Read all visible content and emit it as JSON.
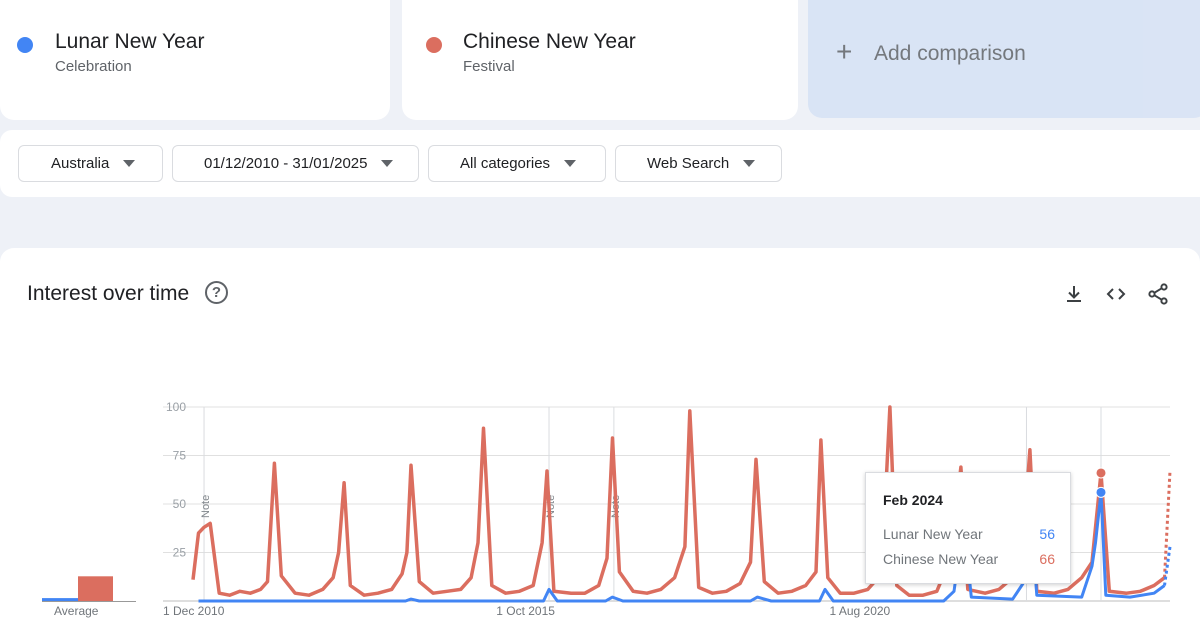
{
  "terms": [
    {
      "name": "Lunar New Year",
      "type": "Celebration",
      "color": "#4285f4"
    },
    {
      "name": "Chinese New Year",
      "type": "Festival",
      "color": "#db6e5f"
    }
  ],
  "add_comparison": {
    "label": "Add comparison",
    "icon": "plus-icon"
  },
  "filters": {
    "region": "Australia",
    "date_range": "01/12/2010 - 31/01/2025",
    "category": "All categories",
    "search_type": "Web Search"
  },
  "panel": {
    "title": "Interest over time",
    "icons": [
      "help-icon",
      "download-icon",
      "embed-icon",
      "share-icon"
    ]
  },
  "average": {
    "label": "Average"
  },
  "tooltip": {
    "date": "Feb 2024",
    "rows": [
      {
        "name": "Lunar New Year",
        "value": "56"
      },
      {
        "name": "Chinese New Year",
        "value": "66"
      }
    ]
  },
  "chart_data": {
    "type": "line",
    "y_ticks": [
      "100",
      "75",
      "50",
      "25"
    ],
    "ylim": [
      0,
      100
    ],
    "x_tick_labels": [
      "1 Dec 2010",
      "1 Oct 2015",
      "1 Aug 2020"
    ],
    "notes": [
      "Note",
      "Note",
      "Note",
      "Note"
    ],
    "grid": true,
    "series": [
      {
        "name": "Lunar New Year",
        "color": "#4285f4",
        "values": [
          [
            2011,
            0
          ],
          [
            2011.2,
            0
          ],
          [
            2014,
            0
          ],
          [
            2014.08,
            1
          ],
          [
            2014.2,
            0
          ],
          [
            2016.0,
            0
          ],
          [
            2016.08,
            6
          ],
          [
            2016.2,
            0
          ],
          [
            2016.9,
            0
          ],
          [
            2017.0,
            2
          ],
          [
            2017.15,
            0
          ],
          [
            2019.0,
            0
          ],
          [
            2019.1,
            2
          ],
          [
            2019.3,
            0
          ],
          [
            2020.0,
            0
          ],
          [
            2020.08,
            6
          ],
          [
            2020.2,
            0
          ],
          [
            2021.8,
            0
          ],
          [
            2021.95,
            5
          ],
          [
            2022.0,
            18
          ],
          [
            2022.08,
            45
          ],
          [
            2022.2,
            2
          ],
          [
            2022.8,
            1
          ],
          [
            2022.95,
            9
          ],
          [
            2023.0,
            25
          ],
          [
            2023.05,
            52
          ],
          [
            2023.15,
            3
          ],
          [
            2023.8,
            2
          ],
          [
            2023.95,
            18
          ],
          [
            2024.0,
            30
          ],
          [
            2024.08,
            56
          ],
          [
            2024.15,
            3
          ],
          [
            2024.5,
            2
          ],
          [
            2024.85,
            4
          ],
          [
            2025.0,
            8
          ]
        ],
        "forecast": [
          [
            2025.0,
            8
          ],
          [
            2025.08,
            28
          ]
        ]
      },
      {
        "name": "Chinese New Year",
        "color": "#db6e5f",
        "values": [
          [
            2010.92,
            11
          ],
          [
            2011.0,
            35
          ],
          [
            2011.08,
            38
          ],
          [
            2011.17,
            40
          ],
          [
            2011.3,
            4
          ],
          [
            2011.45,
            3
          ],
          [
            2011.6,
            5
          ],
          [
            2011.75,
            4
          ],
          [
            2011.9,
            6
          ],
          [
            2012.0,
            10
          ],
          [
            2012.1,
            71
          ],
          [
            2012.2,
            13
          ],
          [
            2012.4,
            4
          ],
          [
            2012.6,
            3
          ],
          [
            2012.8,
            6
          ],
          [
            2012.95,
            12
          ],
          [
            2013.03,
            25
          ],
          [
            2013.11,
            61
          ],
          [
            2013.2,
            8
          ],
          [
            2013.4,
            3
          ],
          [
            2013.6,
            4
          ],
          [
            2013.8,
            6
          ],
          [
            2013.95,
            14
          ],
          [
            2014.02,
            25
          ],
          [
            2014.08,
            70
          ],
          [
            2014.2,
            10
          ],
          [
            2014.4,
            4
          ],
          [
            2014.6,
            5
          ],
          [
            2014.8,
            6
          ],
          [
            2014.95,
            12
          ],
          [
            2015.05,
            30
          ],
          [
            2015.13,
            89
          ],
          [
            2015.25,
            8
          ],
          [
            2015.45,
            4
          ],
          [
            2015.65,
            5
          ],
          [
            2015.85,
            8
          ],
          [
            2015.98,
            30
          ],
          [
            2016.05,
            67
          ],
          [
            2016.15,
            5
          ],
          [
            2016.4,
            4
          ],
          [
            2016.6,
            4
          ],
          [
            2016.8,
            8
          ],
          [
            2016.92,
            22
          ],
          [
            2017.0,
            84
          ],
          [
            2017.1,
            15
          ],
          [
            2017.3,
            5
          ],
          [
            2017.5,
            4
          ],
          [
            2017.7,
            6
          ],
          [
            2017.9,
            12
          ],
          [
            2018.05,
            28
          ],
          [
            2018.12,
            98
          ],
          [
            2018.25,
            7
          ],
          [
            2018.45,
            4
          ],
          [
            2018.65,
            5
          ],
          [
            2018.85,
            9
          ],
          [
            2019.0,
            20
          ],
          [
            2019.08,
            73
          ],
          [
            2019.2,
            10
          ],
          [
            2019.4,
            4
          ],
          [
            2019.6,
            5
          ],
          [
            2019.8,
            8
          ],
          [
            2019.95,
            15
          ],
          [
            2020.02,
            83
          ],
          [
            2020.12,
            12
          ],
          [
            2020.3,
            4
          ],
          [
            2020.5,
            4
          ],
          [
            2020.7,
            6
          ],
          [
            2020.9,
            14
          ],
          [
            2021.02,
            100
          ],
          [
            2021.12,
            8
          ],
          [
            2021.3,
            3
          ],
          [
            2021.5,
            3
          ],
          [
            2021.7,
            5
          ],
          [
            2021.9,
            22
          ],
          [
            2022.05,
            69
          ],
          [
            2022.15,
            6
          ],
          [
            2022.4,
            4
          ],
          [
            2022.6,
            6
          ],
          [
            2022.8,
            12
          ],
          [
            2022.95,
            30
          ],
          [
            2023.05,
            78
          ],
          [
            2023.15,
            5
          ],
          [
            2023.4,
            4
          ],
          [
            2023.6,
            6
          ],
          [
            2023.8,
            12
          ],
          [
            2023.95,
            20
          ],
          [
            2024.08,
            66
          ],
          [
            2024.2,
            5
          ],
          [
            2024.45,
            4
          ],
          [
            2024.65,
            5
          ],
          [
            2024.85,
            8
          ],
          [
            2025.0,
            12
          ]
        ],
        "forecast": [
          [
            2025.0,
            12
          ],
          [
            2025.08,
            67
          ]
        ]
      }
    ],
    "highlight": {
      "date": "Feb 2024",
      "values": [
        56,
        66
      ]
    },
    "average_values": [
      1,
      13
    ]
  }
}
